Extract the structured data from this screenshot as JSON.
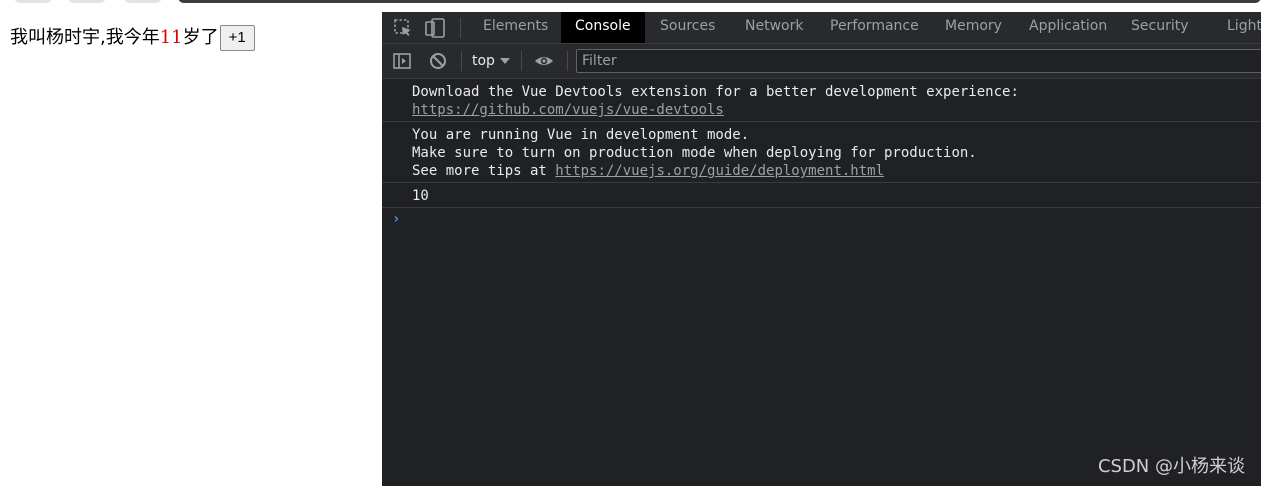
{
  "page": {
    "text_before_age": "我叫杨时宇,我今年",
    "age": "11",
    "text_after_age": "岁了",
    "increment_button": "+1"
  },
  "devtools": {
    "tabs": [
      {
        "label": "Elements",
        "active": false
      },
      {
        "label": "Console",
        "active": true
      },
      {
        "label": "Sources",
        "active": false
      },
      {
        "label": "Network",
        "active": false
      },
      {
        "label": "Performance",
        "active": false
      },
      {
        "label": "Memory",
        "active": false
      },
      {
        "label": "Application",
        "active": false
      },
      {
        "label": "Security",
        "active": false
      },
      {
        "label": "Lighth",
        "active": false
      }
    ],
    "icons": {
      "inspect": "inspect-element-icon",
      "device": "device-toolbar-icon",
      "sidebar": "console-sidebar-icon",
      "clear": "clear-console-icon",
      "eye": "live-expression-icon"
    },
    "toolbar": {
      "context": "top",
      "filter_placeholder": "Filter",
      "filter_value": ""
    },
    "console": {
      "messages": [
        {
          "line1": "Download the Vue Devtools extension for a better development experience:",
          "link": "https://github.com/vuejs/vue-devtools"
        },
        {
          "line1": "You are running Vue in development mode.",
          "line2": "Make sure to turn on production mode when deploying for production.",
          "line3_prefix": "See more tips at ",
          "link": "https://vuejs.org/guide/deployment.html"
        },
        {
          "line1": "10"
        }
      ],
      "prompt": "›"
    }
  },
  "watermark": "CSDN @小杨来谈",
  "colors": {
    "devtools_bg": "#202124",
    "active_tab_bg": "#000000",
    "age_color": "#e00000",
    "prompt_color": "#4d90fe"
  }
}
